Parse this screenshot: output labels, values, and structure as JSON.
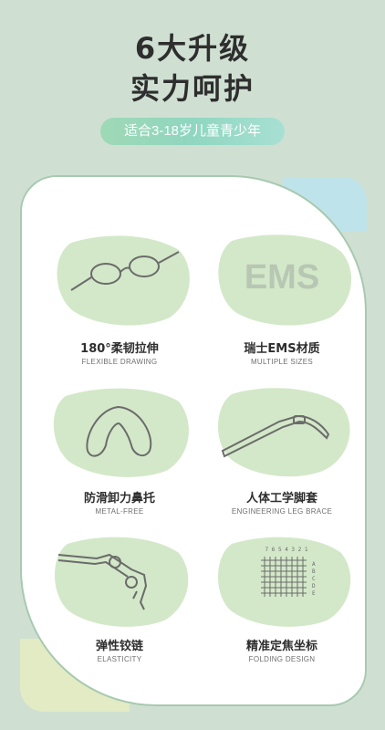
{
  "header": {
    "title_line1": "6大升级",
    "title_line2": "实力呵护",
    "age_pill": "适合3-18岁儿童青少年"
  },
  "features": [
    {
      "title": "180°柔韧拉伸",
      "subtitle": "FLEXIBLE DRAWING",
      "icon": "glasses-icon"
    },
    {
      "title": "瑞士EMS材质",
      "subtitle": "MULTIPLE SIZES",
      "icon": "ems-logo",
      "logo_text": "EMS"
    },
    {
      "title": "防滑卸力鼻托",
      "subtitle": "METAL-FREE",
      "icon": "nose-pad-icon"
    },
    {
      "title": "人体工学脚套",
      "subtitle": "ENGINEERING LEG BRACE",
      "icon": "temple-leg-icon"
    },
    {
      "title": "弹性铰链",
      "subtitle": "ELASTICITY",
      "icon": "hinge-icon"
    },
    {
      "title": "精准定焦坐标",
      "subtitle": "FOLDING DESIGN",
      "icon": "focus-grid-icon",
      "grid_top_labels": "7 6 5 4 3 2 1",
      "grid_side_labels": [
        "A",
        "B",
        "C",
        "D",
        "E"
      ]
    }
  ],
  "colors": {
    "background": "#cfe0d2",
    "blob": "#d3e8c8",
    "accent": "#9fd9b6"
  }
}
